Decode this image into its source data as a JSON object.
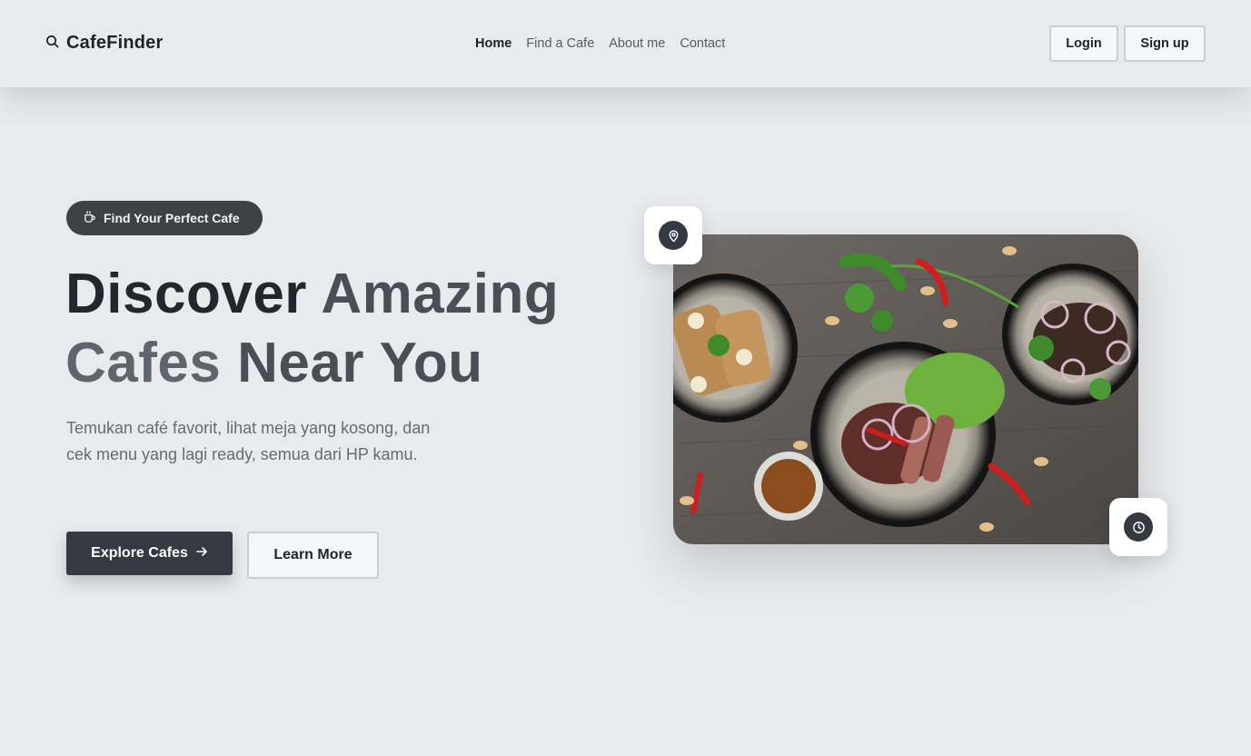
{
  "brand": {
    "name": "CafeFinder",
    "icon": "search-icon"
  },
  "nav": {
    "links": [
      {
        "label": "Home",
        "active": true
      },
      {
        "label": "Find a Cafe",
        "active": false
      },
      {
        "label": "About me",
        "active": false
      },
      {
        "label": "Contact",
        "active": false
      }
    ]
  },
  "auth": {
    "login_label": "Login",
    "signup_label": "Sign up"
  },
  "hero": {
    "badge": {
      "label": "Find Your Perfect Cafe",
      "icon": "coffee-cup-icon"
    },
    "headline": {
      "word1": "Discover",
      "word2": "Amazing",
      "word3": "Cafes",
      "word4": "Near You"
    },
    "subtitle": "Temukan café favorit, lihat meja yang kosong, dan cek menu yang lagi ready, semua dari HP kamu.",
    "primary_button": {
      "label": "Explore Cafes",
      "icon": "arrow-right-icon"
    },
    "secondary_button": {
      "label": "Learn More"
    },
    "floating_icons": [
      "map-pin-icon",
      "clock-icon"
    ]
  },
  "colors": {
    "background": "#e8ebee",
    "primary": "#353a42",
    "text_dark": "#23272d",
    "text_muted": "#646b74"
  }
}
